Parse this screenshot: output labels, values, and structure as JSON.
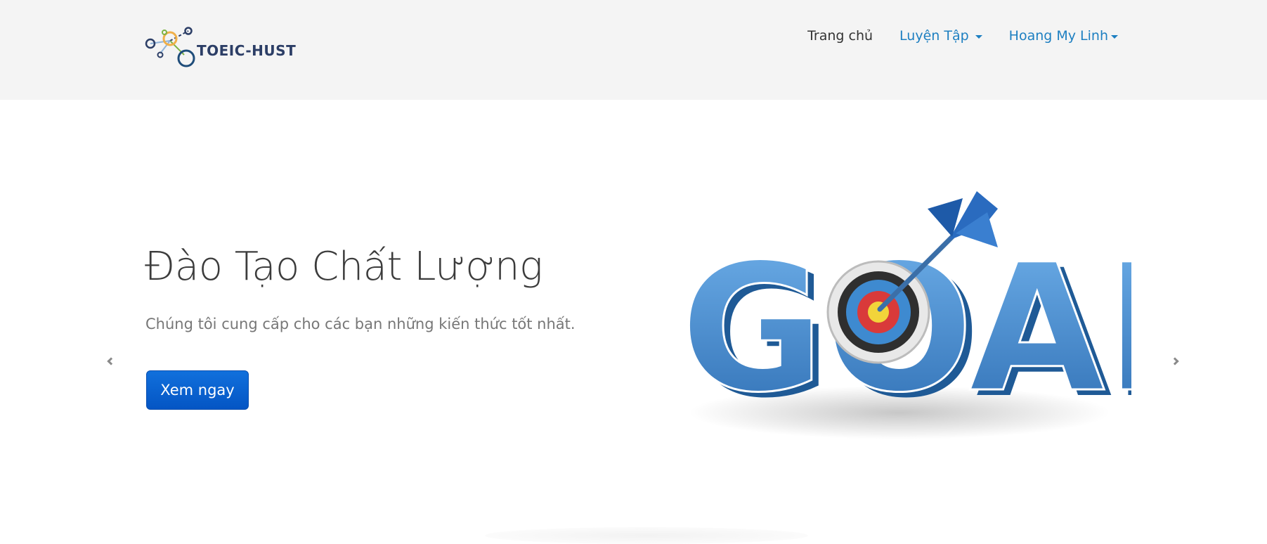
{
  "brand": {
    "name": "TOEIC-HUST",
    "icon": "molecule-logo-icon"
  },
  "nav": {
    "home": "Trang chủ",
    "practice": "Luyện Tập",
    "user": "Hoang My Linh"
  },
  "hero": {
    "title": "Đào Tạo Chất Lượng",
    "subtitle": "Chúng tôi cung cấp cho các bạn những kiến thức tốt nhất.",
    "button": "Xem ngay",
    "image_text": "GOAL"
  },
  "carousel": {
    "prev_icon": "chevron-left-icon",
    "next_icon": "chevron-right-icon"
  },
  "colors": {
    "navbar_bg": "#f4f4f4",
    "link": "#1d7fc1",
    "button": "#0a5fd0",
    "goal_blue": "#3a87cc"
  }
}
